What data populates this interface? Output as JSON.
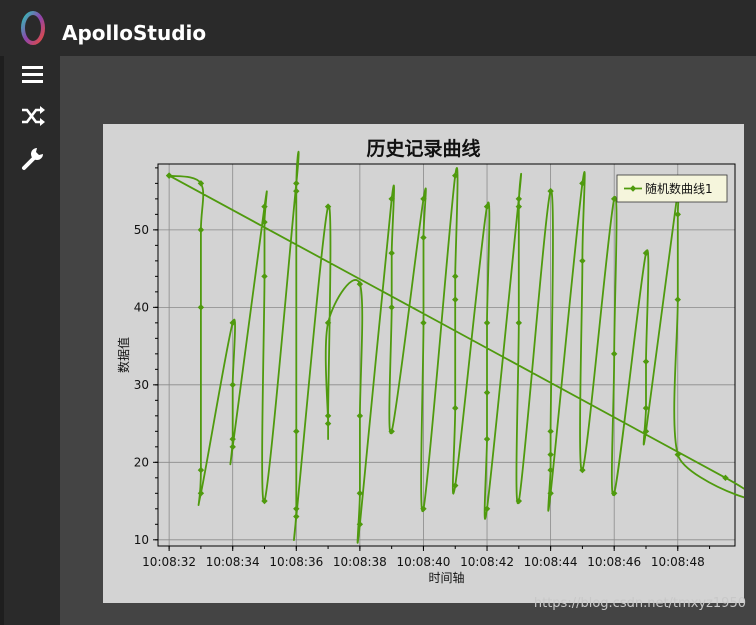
{
  "app": {
    "title": "ApolloStudio",
    "logo_icon": "ring-logo-icon"
  },
  "sidebar": {
    "items": [
      {
        "icon": "menu-icon"
      },
      {
        "icon": "shuffle-icon"
      },
      {
        "icon": "wrench-icon"
      }
    ]
  },
  "watermark": "https://blog.csdn.net/tmxyz1950",
  "chart_data": {
    "type": "line",
    "title": "历史记录曲线",
    "xlabel": "时间轴",
    "ylabel": "数据值",
    "x_ticks": [
      "10:08:32",
      "10:08:34",
      "10:08:36",
      "10:08:38",
      "10:08:40",
      "10:08:42",
      "10:08:44",
      "10:08:46",
      "10:08:48"
    ],
    "y_ticks": [
      10,
      20,
      30,
      40,
      50
    ],
    "xlim": [
      "10:08:31.65",
      "10:08:49.8"
    ],
    "ylim": [
      9.2,
      58.5
    ],
    "grid": true,
    "legend_position": "top-right",
    "line_color": "#4f9a0e",
    "series": [
      {
        "name": "随机数曲线1",
        "x": [
          "10:08:32.0",
          "10:08:33.0",
          "10:08:33.0",
          "10:08:33.0",
          "10:08:33.0",
          "10:08:33.0",
          "10:08:34.0",
          "10:08:34.0",
          "10:08:34.0",
          "10:08:34.0",
          "10:08:35.0",
          "10:08:35.0",
          "10:08:35.0",
          "10:08:35.0",
          "10:08:36.0",
          "10:08:36.0",
          "10:08:36.0",
          "10:08:36.0",
          "10:08:36.0",
          "10:08:37.0",
          "10:08:37.0",
          "10:08:37.0",
          "10:08:37.0",
          "10:08:38.0",
          "10:08:38.0",
          "10:08:38.0",
          "10:08:38.0",
          "10:08:39.0",
          "10:08:39.0",
          "10:08:39.0",
          "10:08:39.0",
          "10:08:40.0",
          "10:08:40.0",
          "10:08:40.0",
          "10:08:40.0",
          "10:08:41.0",
          "10:08:41.0",
          "10:08:41.0",
          "10:08:41.0",
          "10:08:41.0",
          "10:08:42.0",
          "10:08:42.0",
          "10:08:42.0",
          "10:08:42.0",
          "10:08:42.0",
          "10:08:43.0",
          "10:08:43.0",
          "10:08:43.0",
          "10:08:43.0",
          "10:08:44.0",
          "10:08:44.0",
          "10:08:44.0",
          "10:08:44.0",
          "10:08:44.0",
          "10:08:45.0",
          "10:08:45.0",
          "10:08:45.0",
          "10:08:46.0",
          "10:08:46.0",
          "10:08:46.0",
          "10:08:47.0",
          "10:08:47.0",
          "10:08:47.0",
          "10:08:47.0",
          "10:08:48.0",
          "10:08:48.0",
          "10:08:48.0",
          "10:08:48.0",
          "10:08:49.5",
          "10:08:32.0"
        ],
        "values": [
          57,
          56,
          50,
          40,
          19,
          16,
          38,
          30,
          23,
          22,
          53,
          51,
          44,
          15,
          56,
          55,
          24,
          14,
          13,
          53,
          26,
          25,
          38,
          43,
          26,
          16,
          12,
          54,
          47,
          40,
          24,
          54,
          49,
          38,
          14,
          57,
          44,
          41,
          27,
          17,
          53,
          38,
          29,
          23,
          14,
          54,
          53,
          38,
          15,
          55,
          24,
          21,
          19,
          16,
          56,
          46,
          19,
          54,
          34,
          16,
          47,
          33,
          27,
          24,
          55,
          52,
          41,
          21,
          18,
          57
        ]
      }
    ]
  }
}
